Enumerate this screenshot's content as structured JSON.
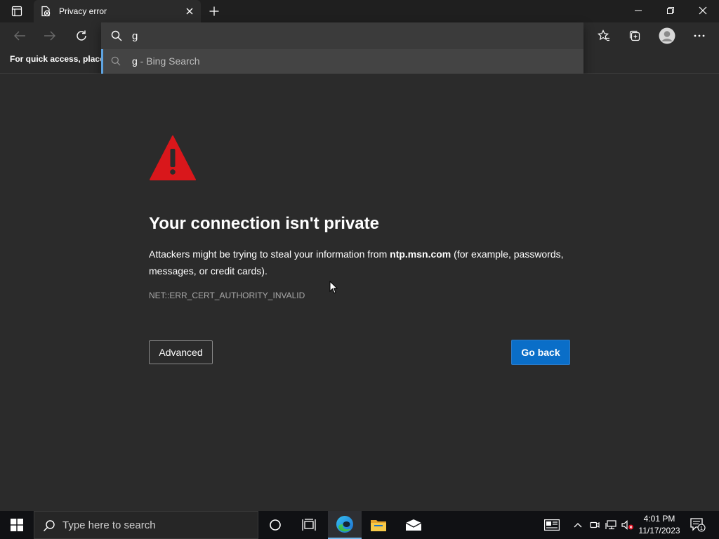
{
  "browser": {
    "tab": {
      "title": "Privacy error"
    },
    "omnibox": {
      "value": "g",
      "suggestion_query": "g",
      "suggestion_rest": " - Bing Search"
    },
    "favorites_hint": "For quick access, place y"
  },
  "page": {
    "heading": "Your connection isn't private",
    "description_before": "Attackers might be trying to steal your information from ",
    "description_domain": "ntp.msn.com",
    "description_after": " (for example, passwords, messages, or credit cards).",
    "error_code": "NET::ERR_CERT_AUTHORITY_INVALID",
    "advanced_label": "Advanced",
    "goback_label": "Go back"
  },
  "colors": {
    "warning_red": "#d9171b",
    "primary_button": "#0a6ec8",
    "suggestion_accent": "#5ea3e0"
  },
  "taskbar": {
    "search_placeholder": "Type here to search",
    "time": "4:01 PM",
    "date": "11/17/2023",
    "notification_count": "1",
    "pinned": [
      "cortana-icon",
      "task-view-icon",
      "edge-icon",
      "file-explorer-icon",
      "mail-icon"
    ]
  }
}
